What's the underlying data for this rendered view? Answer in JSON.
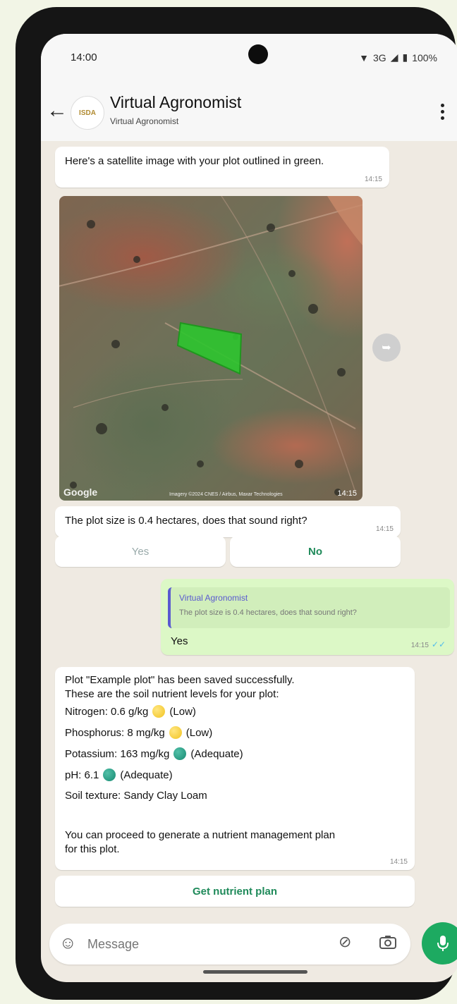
{
  "status": {
    "time": "14:00",
    "network": "3G",
    "battery": "100%"
  },
  "header": {
    "title": "Virtual Agronomist",
    "subtitle": "Virtual Agronomist",
    "avatar_text": "ISDA"
  },
  "messages": {
    "satellite_text": "Here's a satellite image with your plot outlined in green.",
    "satellite_text_time": "14:15",
    "image_google": "Google",
    "image_credit": "Imagery ©2024 CNES / Airbus, Maxar Technologies",
    "image_time": "14:15",
    "plot_question": "The plot size is 0.4 hectares, does that sound right?",
    "plot_question_time": "14:15",
    "reply_yes": "Yes",
    "reply_no": "No",
    "outgoing_quote_sender": "Virtual Agronomist",
    "outgoing_quote_text": "The plot size is 0.4 hectares, does that sound right?",
    "outgoing_text": "Yes",
    "outgoing_time": "14:15",
    "nutrient_intro_1": "Plot \"Example plot\" has been saved successfully.",
    "nutrient_intro_2": "These are the soil nutrient levels for your plot:",
    "nitrogen": "Nitrogen: 0.6 g/kg",
    "nitrogen_level": "(Low)",
    "phosphorus": "Phosphorus: 8 mg/kg",
    "phosphorus_level": "(Low)",
    "potassium": "Potassium: 163 mg/kg",
    "potassium_level": "(Adequate)",
    "ph": "pH: 6.1",
    "ph_level": "(Adequate)",
    "soil_texture": "Soil texture: Sandy Clay Loam",
    "proceed_1": "You can proceed to generate a nutrient management plan",
    "proceed_2": "for this plot.",
    "nutrient_time": "14:15",
    "plan_button": "Get nutrient plan"
  },
  "input": {
    "placeholder": "Message"
  },
  "colors": {
    "accent": "#1daa61",
    "outgoing_bubble": "#dcf8c6",
    "chat_bg": "#efeae2",
    "plot_outline": "#2fc42f"
  }
}
